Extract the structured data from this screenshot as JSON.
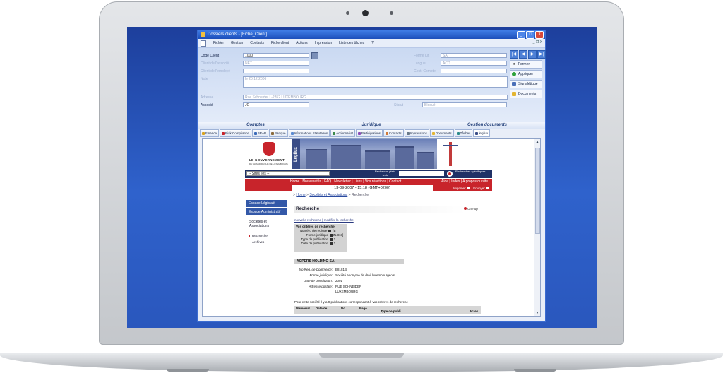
{
  "window": {
    "title": "Dossiers clients - [Fiche_Client]",
    "controls": {
      "minimize": "_",
      "maximize": "□",
      "close": "X"
    },
    "menu": [
      "Fichier",
      "Gestion",
      "Contacts",
      "Fiche client",
      "Actions",
      "Impression",
      "Liste des tâches",
      "?"
    ],
    "mdi_controls": "_ ❐ X"
  },
  "form": {
    "code_client_label": "Code Client",
    "code_client_value": "1000",
    "field2_label": "Client de l'associé",
    "field2_value": "NET",
    "field3_label": "Client de l'employé",
    "field4_label": "Note",
    "field4_value": "le 20.12.2006",
    "address_label": "Adresse",
    "address_value": "Rue Schneider L-2852 LUXEMBOURG",
    "associe_label": "Associé",
    "associe_value": "JG",
    "right_label1": "Forme jur.",
    "right_value1": "SA",
    "right_label2": "Langue",
    "right_value2": "ACD",
    "right_label3": "Gest. Compte",
    "statut_label": "Statut",
    "statut_value": "Bloqué"
  },
  "side_buttons": {
    "nav_arrows": [
      "|◀",
      "◀",
      "▶",
      "▶|"
    ],
    "fermer": "Fermer",
    "appliquer": "Appliquer",
    "signaletique": "Signalétique",
    "documents": "Documents"
  },
  "sections": [
    "Comptes",
    "Juridique",
    "Gestion documents"
  ],
  "tabs": [
    "Finance",
    "Risk Compliance",
    "BRAP",
    "Banque",
    "Informations Statutaires",
    "Actionnariat",
    "Participations",
    "Contacts",
    "Impressions",
    "Documents",
    "Tâches",
    "legilux"
  ],
  "colors": {
    "desktop": "#2f62cc",
    "titlebar": "#1c4fbb",
    "gov_red": "#c8242b",
    "gov_navy": "#1f3166",
    "nav_blue": "#3358a8"
  },
  "web": {
    "gov_title": "LE GOUVERNEMENT",
    "gov_subtitle": "DU GRAND-DUCHÉ DE LUXEMBOURG",
    "legilux": "Legilux",
    "sites_select": "-- Sites liés --",
    "search_label": "Recherche plein-texte",
    "search_label2": "Recherches spécifiques",
    "nav_links": "Home | Nouveautés | FAQ | Newsletter | Liens | Vos réactions | Contact",
    "aide_links": "Aide | Index | A propos du site",
    "datetime": "13-09-2007 - 15:18 (GMT+0200)",
    "imprimer": "Imprimer",
    "envoyer": "Envoyer",
    "breadcrumb_prefix": "> ",
    "breadcrumb_home": "Home",
    "breadcrumb_sep": " > ",
    "breadcrumb_soc": "Sociétés et Associations",
    "breadcrumb_current": " > Recherche",
    "leftnav": {
      "btn1": "Espace Législatif",
      "btn2": "Espace Administratif",
      "item1": "Sociétés et Associations",
      "sub1": "Recherche",
      "sub2": "Archives"
    },
    "heading": "Recherche",
    "one_up": "One up",
    "links": "nouvelle recherche | modifier la recherche",
    "criteria": {
      "title": "Vos critères de recherche:",
      "rows": [
        {
          "k": "Numéro de registre",
          "v": "[B 51.818]"
        },
        {
          "k": "Forme juridique",
          "v": "*"
        },
        {
          "k": "Type de publication",
          "v": "*"
        },
        {
          "k": "Date de publication",
          "v": "*"
        }
      ]
    },
    "company_name": "ACPERS HOLDING SA",
    "details": [
      {
        "k": "No Reg. de Commerce:",
        "v": "B8181B"
      },
      {
        "k": "Forme juridique:",
        "v": "Société anonyme de droit luxembourgeois"
      },
      {
        "k": "Date de constitution:",
        "v": "2001"
      },
      {
        "k": "Adresse postale:",
        "v": "RUE SCHNEIDER"
      },
      {
        "k": "",
        "v": "LUXEMBOURG"
      }
    ],
    "note": "Pour cette société il y a 9 publications correspondant à vos critères de recherche",
    "table_headers": [
      "Mémorial",
      "Date de",
      "No",
      "Page",
      "Type de publi",
      "Actes"
    ]
  }
}
